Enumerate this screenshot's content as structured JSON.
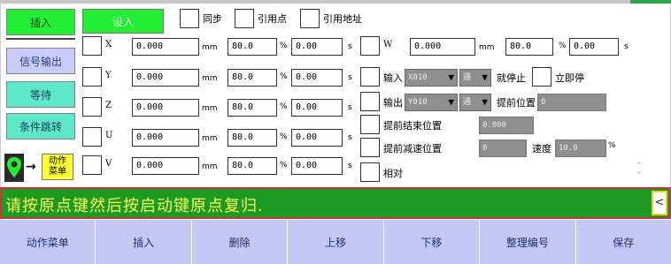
{
  "nav": {
    "insert": "插入",
    "signal_output": "信号输出",
    "wait": "等待",
    "conditional_jump": "条件跳转"
  },
  "action_menu_label": "动作\n菜单",
  "header": {
    "set_in": "设入",
    "sync": "同步",
    "ref_point": "引用点",
    "ref_address": "引用地址"
  },
  "axes": [
    {
      "name": "X",
      "position": "0.000",
      "pos_unit": "mm",
      "speed": "80.0",
      "speed_unit": "%",
      "delay": "0.00",
      "delay_unit": "s"
    },
    {
      "name": "Y",
      "position": "0.000",
      "pos_unit": "mm",
      "speed": "80.0",
      "speed_unit": "%",
      "delay": "0.00",
      "delay_unit": "s"
    },
    {
      "name": "Z",
      "position": "0.000",
      "pos_unit": "mm",
      "speed": "80.0",
      "speed_unit": "%",
      "delay": "0.00",
      "delay_unit": "s"
    },
    {
      "name": "U",
      "position": "0.000",
      "pos_unit": "mm",
      "speed": "80.0",
      "speed_unit": "%",
      "delay": "0.00",
      "delay_unit": "s"
    },
    {
      "name": "V",
      "position": "0.000",
      "pos_unit": "mm",
      "speed": "80.0",
      "speed_unit": "%",
      "delay": "0.00",
      "delay_unit": "s"
    }
  ],
  "w_axis": {
    "name": "W",
    "position": "0.000",
    "pos_unit": "mm",
    "speed": "80.0",
    "speed_unit": "%",
    "delay": "0.00",
    "delay_unit": "s"
  },
  "right_panel": {
    "input_label": "输入",
    "input_port": "X010",
    "input_state": "通",
    "stop_label": "就停止",
    "immediate_stop": "立即停",
    "output_label": "输出",
    "output_port": "Y010",
    "output_state": "通",
    "advance_pos_label": "提前位置",
    "advance_pos_value": "0",
    "advance_end_label": "提前结束位置",
    "advance_end_value": "0.000",
    "advance_decel_label": "提前减速位置",
    "advance_decel_value": "0",
    "speed_label": "速度",
    "speed_value": "10.0",
    "speed_unit": "%",
    "relative_label": "相对"
  },
  "message": "请按原点键然后按启动键原点复归.",
  "message_btn": "<",
  "toolbar": [
    "动作菜单",
    "插入",
    "删除",
    "上移",
    "下移",
    "整理编号",
    "保存"
  ],
  "colors": {
    "bright_green": "#22ee33",
    "message_bg": "#1c9a22",
    "message_text": "#ffff55",
    "toolbar_bg": "#c6c8f4",
    "action_yellow": "#ffff33"
  }
}
